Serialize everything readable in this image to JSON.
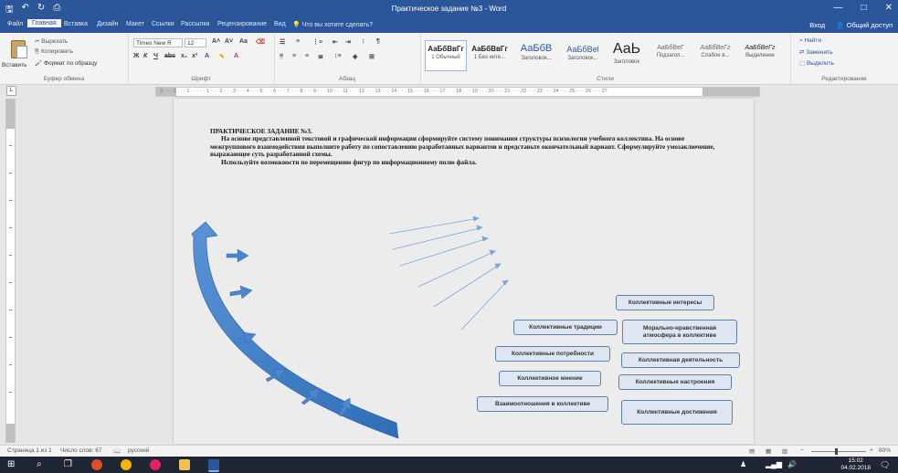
{
  "window": {
    "title": "Практическое задание №3 - Word",
    "controls": [
      "—",
      "□",
      "✕"
    ]
  },
  "qat": [
    "save-icon",
    "undo-icon",
    "redo-icon",
    "print-preview-icon"
  ],
  "tabs": [
    "Файл",
    "Главная",
    "Вставка",
    "Дизайн",
    "Макет",
    "Ссылки",
    "Рассылки",
    "Рецензирование",
    "Вид",
    "Что вы хотите сделать?"
  ],
  "active_tab": "Главная",
  "account": {
    "signin": "Вход",
    "share": "Общий доступ"
  },
  "ribbon": {
    "clipboard": {
      "paste": "Вставить",
      "cut": "Вырезать",
      "copy": "Копировать",
      "format_painter": "Формат по образцу",
      "label": "Буфер обмена"
    },
    "font": {
      "name": "Times New R",
      "size": "12",
      "label": "Шрифт"
    },
    "paragraph": {
      "label": "Абзац"
    },
    "styles": {
      "label": "Стили",
      "items": [
        {
          "sample": "АаБбВвГг",
          "name": "1 Обычный"
        },
        {
          "sample": "АаБбВвГг",
          "name": "1 Без инте..."
        },
        {
          "sample": "АаБбВ",
          "name": "Заголовок..."
        },
        {
          "sample": "АаБбВеl",
          "name": "Заголовок..."
        },
        {
          "sample": "АаЬ",
          "name": "Заголовок"
        },
        {
          "sample": "АаБбВеГ",
          "name": "Подзагол..."
        },
        {
          "sample": "АаБбВеГг",
          "name": "Слабое в..."
        },
        {
          "sample": "АаБбВеГг",
          "name": "Выделение"
        }
      ]
    },
    "editing": {
      "find": "Найти",
      "replace": "Заменить",
      "select": "Выделить",
      "label": "Редактирование"
    }
  },
  "ruler": {
    "numbers": "3 · · · 2 · · · 1 · · · · · 1 · · · 2 · · · 3 · · · 4 · · · 5 · · · 6 · · · 7 · · · 8 · · · 9 · · · 10 · · · 11 · · · 12 · · · 13 · · · 14 · · · 15 · · · 16 · · · 17 · · · 18 · · · 19 · · · 20 · · · 21 · · · 22 · · · 23 · · · 24 · · · 25 · · · 26 · · · 27"
  },
  "document": {
    "title": "ПРАКТИЧЕСКОЕ ЗАДАНИЕ №3.",
    "para1": "На основе представленной текстовой и графической информации сформируйте систему понимания структуры психологии учебного коллектива. На основе межгруппового взаимодействия выполните работу по сопоставлению разработанных вариантов и представьте окончательный вариант. Сформулируйте умозаключение, выражающее суть разработанной схемы.",
    "para2": "Используйте возможности по перемещению фигур по информационному полю файла.",
    "boxes": [
      "Коллективные интересы",
      "Коллективные традиции",
      "Морально-нравственная атмосфера в коллективе",
      "Коллективные потребности",
      "Коллективная деятельность",
      "Коллективное мнение",
      "Коллективные настроения",
      "Взаимоотношения в коллективе",
      "Коллективные достижения"
    ]
  },
  "status": {
    "page": "Страница 1 из 1",
    "words": "Число слов: 67",
    "language": "русский",
    "zoom": "80%"
  },
  "taskbar": {
    "time": "15:02",
    "date": "04.02.2018"
  },
  "colors": {
    "word_blue": "#2b579a",
    "arrow_blue": "#4a86cf",
    "box_fill": "#dde6f1"
  }
}
